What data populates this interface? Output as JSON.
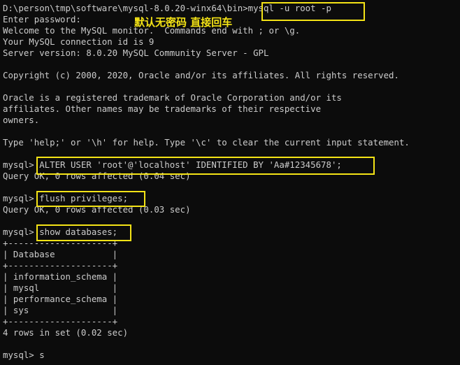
{
  "terminal": {
    "lines": [
      "D:\\person\\tmp\\software\\mysql-8.0.20-winx64\\bin>mysql -u root -p",
      "Enter password:",
      "Welcome to the MySQL monitor.  Commands end with ; or \\g.",
      "Your MySQL connection id is 9",
      "Server version: 8.0.20 MySQL Community Server - GPL",
      "",
      "Copyright (c) 2000, 2020, Oracle and/or its affiliates. All rights reserved.",
      "",
      "Oracle is a registered trademark of Oracle Corporation and/or its",
      "affiliates. Other names may be trademarks of their respective",
      "owners.",
      "",
      "Type 'help;' or '\\h' for help. Type '\\c' to clear the current input statement.",
      "",
      "mysql> ALTER USER 'root'@'localhost' IDENTIFIED BY 'Aa#12345678';",
      "Query OK, 0 rows affected (0.04 sec)",
      "",
      "mysql> flush privileges;",
      "Query OK, 0 rows affected (0.03 sec)",
      "",
      "mysql> show databases;",
      "+--------------------+",
      "| Database           |",
      "+--------------------+",
      "| information_schema |",
      "| mysql              |",
      "| performance_schema |",
      "| sys                |",
      "+--------------------+",
      "4 rows in set (0.02 sec)",
      "",
      "mysql> s"
    ]
  },
  "annotation": {
    "text": "默认无密码 直接回车"
  },
  "colors": {
    "background": "#0c0c0c",
    "text": "#cccccc",
    "highlight": "#f4e316"
  }
}
